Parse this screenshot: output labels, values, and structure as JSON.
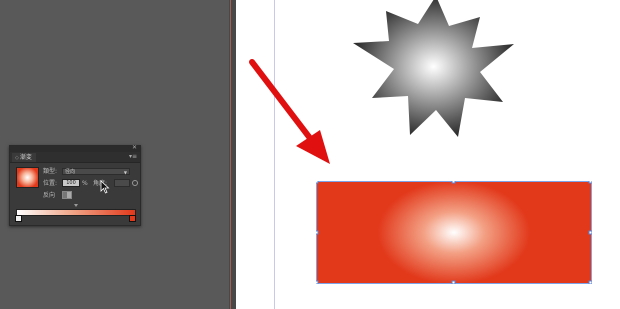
{
  "gradient_panel": {
    "close_icon": "close-icon",
    "menu_icon": "panel-menu-icon",
    "tab_label": "漸変",
    "type_label": "類型:",
    "type_value": "径向",
    "position_label": "位置:",
    "position_value": "100",
    "position_unit": "%",
    "angle_label": "角度:",
    "reverse_label": "反向",
    "gradient_colors": [
      "#ffffff",
      "#e2391b"
    ]
  },
  "canvas": {
    "star_colors": [
      "#ffffff",
      "#2e2e2e"
    ],
    "rect_colors": [
      "#ffffff",
      "#e2391b"
    ],
    "arrow_color": "#e01010"
  }
}
